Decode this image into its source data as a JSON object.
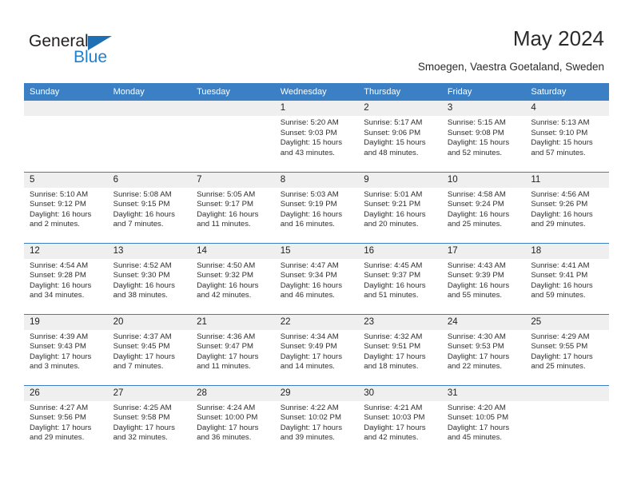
{
  "brand": {
    "name_dark": "General",
    "name_blue": "Blue",
    "accent_blue": "#1f7fd0",
    "triangle_blue": "#1f6fb5"
  },
  "header": {
    "title": "May 2024",
    "subtitle": "Smoegen, Vaestra Goetaland, Sweden"
  },
  "calendar": {
    "header_bg": "#3b7fc4",
    "daynum_bg": "#efefef",
    "weekdays": [
      "Sunday",
      "Monday",
      "Tuesday",
      "Wednesday",
      "Thursday",
      "Friday",
      "Saturday"
    ],
    "weeks": [
      [
        {
          "day": "",
          "empty": true
        },
        {
          "day": "",
          "empty": true
        },
        {
          "day": "",
          "empty": true
        },
        {
          "day": "1",
          "sunrise": "Sunrise: 5:20 AM",
          "sunset": "Sunset: 9:03 PM",
          "daylight_line1": "Daylight: 15 hours",
          "daylight_line2": "and 43 minutes."
        },
        {
          "day": "2",
          "sunrise": "Sunrise: 5:17 AM",
          "sunset": "Sunset: 9:06 PM",
          "daylight_line1": "Daylight: 15 hours",
          "daylight_line2": "and 48 minutes."
        },
        {
          "day": "3",
          "sunrise": "Sunrise: 5:15 AM",
          "sunset": "Sunset: 9:08 PM",
          "daylight_line1": "Daylight: 15 hours",
          "daylight_line2": "and 52 minutes."
        },
        {
          "day": "4",
          "sunrise": "Sunrise: 5:13 AM",
          "sunset": "Sunset: 9:10 PM",
          "daylight_line1": "Daylight: 15 hours",
          "daylight_line2": "and 57 minutes."
        }
      ],
      [
        {
          "day": "5",
          "sunrise": "Sunrise: 5:10 AM",
          "sunset": "Sunset: 9:12 PM",
          "daylight_line1": "Daylight: 16 hours",
          "daylight_line2": "and 2 minutes."
        },
        {
          "day": "6",
          "sunrise": "Sunrise: 5:08 AM",
          "sunset": "Sunset: 9:15 PM",
          "daylight_line1": "Daylight: 16 hours",
          "daylight_line2": "and 7 minutes."
        },
        {
          "day": "7",
          "sunrise": "Sunrise: 5:05 AM",
          "sunset": "Sunset: 9:17 PM",
          "daylight_line1": "Daylight: 16 hours",
          "daylight_line2": "and 11 minutes."
        },
        {
          "day": "8",
          "sunrise": "Sunrise: 5:03 AM",
          "sunset": "Sunset: 9:19 PM",
          "daylight_line1": "Daylight: 16 hours",
          "daylight_line2": "and 16 minutes."
        },
        {
          "day": "9",
          "sunrise": "Sunrise: 5:01 AM",
          "sunset": "Sunset: 9:21 PM",
          "daylight_line1": "Daylight: 16 hours",
          "daylight_line2": "and 20 minutes."
        },
        {
          "day": "10",
          "sunrise": "Sunrise: 4:58 AM",
          "sunset": "Sunset: 9:24 PM",
          "daylight_line1": "Daylight: 16 hours",
          "daylight_line2": "and 25 minutes."
        },
        {
          "day": "11",
          "sunrise": "Sunrise: 4:56 AM",
          "sunset": "Sunset: 9:26 PM",
          "daylight_line1": "Daylight: 16 hours",
          "daylight_line2": "and 29 minutes."
        }
      ],
      [
        {
          "day": "12",
          "sunrise": "Sunrise: 4:54 AM",
          "sunset": "Sunset: 9:28 PM",
          "daylight_line1": "Daylight: 16 hours",
          "daylight_line2": "and 34 minutes."
        },
        {
          "day": "13",
          "sunrise": "Sunrise: 4:52 AM",
          "sunset": "Sunset: 9:30 PM",
          "daylight_line1": "Daylight: 16 hours",
          "daylight_line2": "and 38 minutes."
        },
        {
          "day": "14",
          "sunrise": "Sunrise: 4:50 AM",
          "sunset": "Sunset: 9:32 PM",
          "daylight_line1": "Daylight: 16 hours",
          "daylight_line2": "and 42 minutes."
        },
        {
          "day": "15",
          "sunrise": "Sunrise: 4:47 AM",
          "sunset": "Sunset: 9:34 PM",
          "daylight_line1": "Daylight: 16 hours",
          "daylight_line2": "and 46 minutes."
        },
        {
          "day": "16",
          "sunrise": "Sunrise: 4:45 AM",
          "sunset": "Sunset: 9:37 PM",
          "daylight_line1": "Daylight: 16 hours",
          "daylight_line2": "and 51 minutes."
        },
        {
          "day": "17",
          "sunrise": "Sunrise: 4:43 AM",
          "sunset": "Sunset: 9:39 PM",
          "daylight_line1": "Daylight: 16 hours",
          "daylight_line2": "and 55 minutes."
        },
        {
          "day": "18",
          "sunrise": "Sunrise: 4:41 AM",
          "sunset": "Sunset: 9:41 PM",
          "daylight_line1": "Daylight: 16 hours",
          "daylight_line2": "and 59 minutes."
        }
      ],
      [
        {
          "day": "19",
          "sunrise": "Sunrise: 4:39 AM",
          "sunset": "Sunset: 9:43 PM",
          "daylight_line1": "Daylight: 17 hours",
          "daylight_line2": "and 3 minutes."
        },
        {
          "day": "20",
          "sunrise": "Sunrise: 4:37 AM",
          "sunset": "Sunset: 9:45 PM",
          "daylight_line1": "Daylight: 17 hours",
          "daylight_line2": "and 7 minutes."
        },
        {
          "day": "21",
          "sunrise": "Sunrise: 4:36 AM",
          "sunset": "Sunset: 9:47 PM",
          "daylight_line1": "Daylight: 17 hours",
          "daylight_line2": "and 11 minutes."
        },
        {
          "day": "22",
          "sunrise": "Sunrise: 4:34 AM",
          "sunset": "Sunset: 9:49 PM",
          "daylight_line1": "Daylight: 17 hours",
          "daylight_line2": "and 14 minutes."
        },
        {
          "day": "23",
          "sunrise": "Sunrise: 4:32 AM",
          "sunset": "Sunset: 9:51 PM",
          "daylight_line1": "Daylight: 17 hours",
          "daylight_line2": "and 18 minutes."
        },
        {
          "day": "24",
          "sunrise": "Sunrise: 4:30 AM",
          "sunset": "Sunset: 9:53 PM",
          "daylight_line1": "Daylight: 17 hours",
          "daylight_line2": "and 22 minutes."
        },
        {
          "day": "25",
          "sunrise": "Sunrise: 4:29 AM",
          "sunset": "Sunset: 9:55 PM",
          "daylight_line1": "Daylight: 17 hours",
          "daylight_line2": "and 25 minutes."
        }
      ],
      [
        {
          "day": "26",
          "sunrise": "Sunrise: 4:27 AM",
          "sunset": "Sunset: 9:56 PM",
          "daylight_line1": "Daylight: 17 hours",
          "daylight_line2": "and 29 minutes."
        },
        {
          "day": "27",
          "sunrise": "Sunrise: 4:25 AM",
          "sunset": "Sunset: 9:58 PM",
          "daylight_line1": "Daylight: 17 hours",
          "daylight_line2": "and 32 minutes."
        },
        {
          "day": "28",
          "sunrise": "Sunrise: 4:24 AM",
          "sunset": "Sunset: 10:00 PM",
          "daylight_line1": "Daylight: 17 hours",
          "daylight_line2": "and 36 minutes."
        },
        {
          "day": "29",
          "sunrise": "Sunrise: 4:22 AM",
          "sunset": "Sunset: 10:02 PM",
          "daylight_line1": "Daylight: 17 hours",
          "daylight_line2": "and 39 minutes."
        },
        {
          "day": "30",
          "sunrise": "Sunrise: 4:21 AM",
          "sunset": "Sunset: 10:03 PM",
          "daylight_line1": "Daylight: 17 hours",
          "daylight_line2": "and 42 minutes."
        },
        {
          "day": "31",
          "sunrise": "Sunrise: 4:20 AM",
          "sunset": "Sunset: 10:05 PM",
          "daylight_line1": "Daylight: 17 hours",
          "daylight_line2": "and 45 minutes."
        },
        {
          "day": "",
          "empty": true
        }
      ]
    ]
  }
}
